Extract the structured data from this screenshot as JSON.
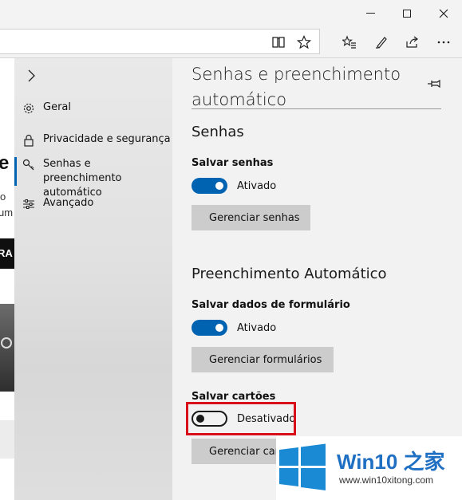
{
  "settings": {
    "heading": "Senhas e preenchimento automático",
    "sections": {
      "passwords": {
        "title": "Senhas",
        "save_passwords_label": "Salvar senhas",
        "save_passwords_state": "Ativado",
        "manage_button": "Gerenciar senhas"
      },
      "autofill": {
        "title": "Preenchimento Automático",
        "save_form_data_label": "Salvar dados de formulário",
        "save_form_data_state": "Ativado",
        "manage_forms_button": "Gerenciar formulários",
        "save_cards_label": "Salvar cartões",
        "save_cards_state": "Desativado",
        "manage_cards_button": "Gerenciar cartões"
      }
    }
  },
  "nav": {
    "items": [
      {
        "label": "Geral",
        "icon": "gear-icon"
      },
      {
        "label": "Privacidade e segurança",
        "icon": "lock-icon"
      },
      {
        "label": "Senhas e preenchimento automático",
        "icon": "key-icon",
        "active": true
      },
      {
        "label": "Avançado",
        "icon": "sliders-icon"
      }
    ]
  },
  "page_behind": {
    "fragments": [
      "e",
      "o",
      "um",
      "RA"
    ]
  },
  "watermark": {
    "brand": "Win10 之家",
    "url": "www.win10xitong.com"
  },
  "colors": {
    "accent": "#0063b1",
    "highlight": "#d9101a",
    "watermark_blue": "#1f6fc3"
  }
}
